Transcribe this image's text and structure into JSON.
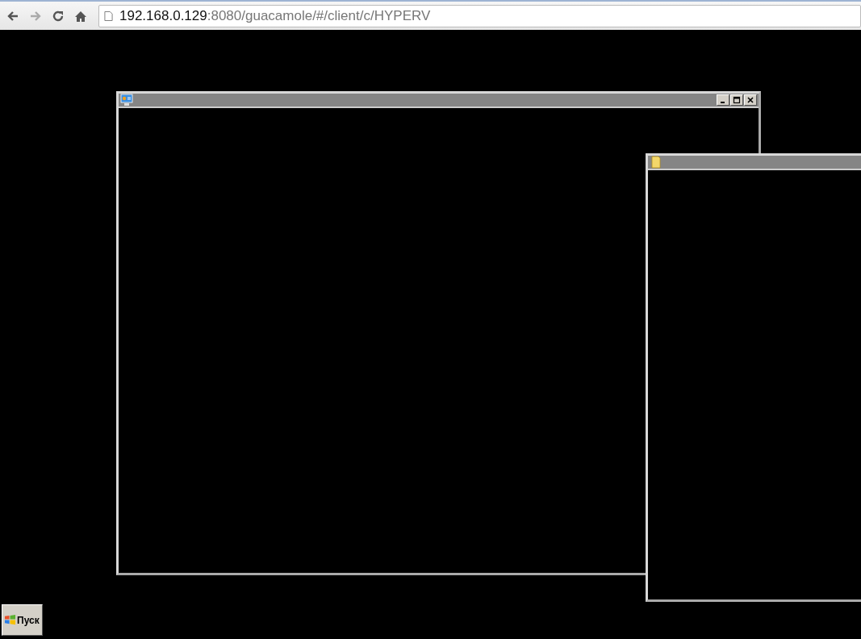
{
  "browser": {
    "address": {
      "host": "192.168.0.129",
      "rest": ":8080/guacamole/#/client/c/HYPERV"
    }
  },
  "desktop": {
    "windows": [
      {
        "kind": "app",
        "controls": true
      },
      {
        "kind": "folder",
        "controls": false
      }
    ],
    "start_button": {
      "label": "Пуск"
    }
  }
}
